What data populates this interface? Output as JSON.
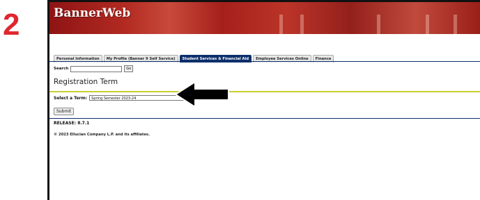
{
  "step": {
    "number": "2"
  },
  "banner": {
    "title": "BannerWeb"
  },
  "tabs": [
    {
      "label": "Personal Information",
      "active": false
    },
    {
      "label": "My Profile (Banner 9 Self Service)",
      "active": false
    },
    {
      "label": "Student Services & Financial Aid",
      "active": true
    },
    {
      "label": "Employee Services Online",
      "active": false
    },
    {
      "label": "Finance",
      "active": false
    }
  ],
  "search": {
    "label": "Search",
    "value": "",
    "go_label": "Go"
  },
  "page": {
    "title": "Registration Term"
  },
  "term": {
    "label": "Select a Term:",
    "selected": "Spring Semester 2023-24",
    "chevron": "⌄"
  },
  "submit": {
    "label": "Submit"
  },
  "footer": {
    "release": "RELEASE: 8.7.1",
    "copyright": "© 2023 Ellucian Company L.P. and its affiliates."
  },
  "colors": {
    "step_red": "#e0262f",
    "nav_blue": "#0c2f6b",
    "divider_yellow": "#c8cc32"
  },
  "icons": {
    "arrow": "left-pointing-arrow-icon"
  }
}
